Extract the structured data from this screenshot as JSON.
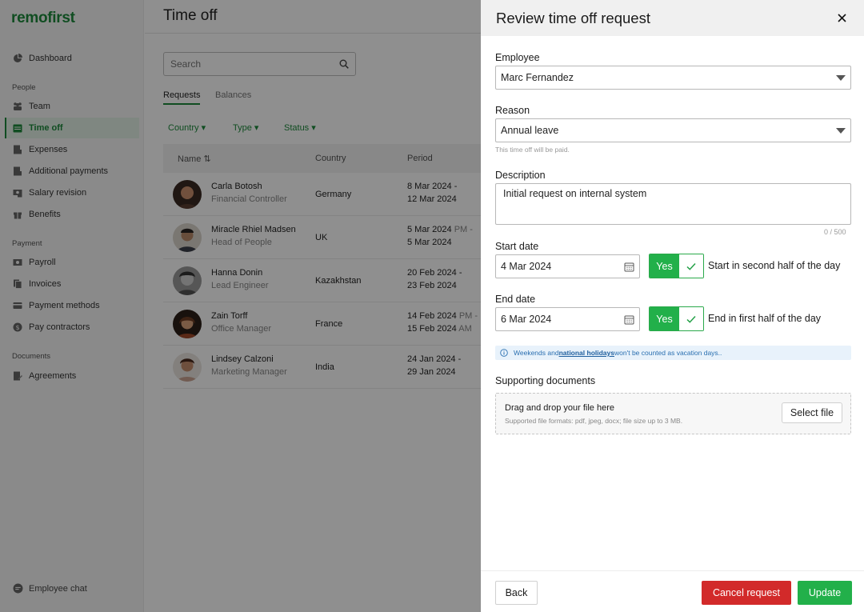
{
  "app": {
    "logo": "remofirst",
    "page_title": "Time off"
  },
  "sidebar": {
    "dashboard": "Dashboard",
    "section_people": "People",
    "team": "Team",
    "time_off": "Time off",
    "expenses": "Expenses",
    "additional_payments": "Additional payments",
    "salary_revision": "Salary revision",
    "benefits": "Benefits",
    "section_payment": "Payment",
    "payroll": "Payroll",
    "invoices": "Invoices",
    "payment_methods": "Payment methods",
    "pay_contractors": "Pay contractors",
    "section_documents": "Documents",
    "agreements": "Agreements",
    "employee_chat": "Employee chat"
  },
  "main": {
    "search_placeholder": "Search",
    "tabs": [
      "Requests",
      "Balances"
    ],
    "filters": [
      "Country",
      "Type",
      "Status"
    ],
    "columns": {
      "name": "Name ⇅",
      "country": "Country",
      "period": "Period"
    },
    "rows": [
      {
        "name": "Carla Botosh",
        "role": "Financial Controller",
        "country": "Germany",
        "p1": "8 Mar 2024 -",
        "p1_suffix": "",
        "p2": "12 Mar 2024",
        "p2_suffix": ""
      },
      {
        "name": "Miracle Rhiel Madsen",
        "role": "Head of People",
        "country": "UK",
        "p1": "5 Mar 2024",
        "p1_suffix": " PM -",
        "p2": "5 Mar 2024",
        "p2_suffix": ""
      },
      {
        "name": "Hanna Donin",
        "role": "Lead Engineer",
        "country": "Kazakhstan",
        "p1": "20 Feb 2024 -",
        "p1_suffix": "",
        "p2": "23 Feb 2024",
        "p2_suffix": ""
      },
      {
        "name": "Zain Torff",
        "role": "Office Manager",
        "country": "France",
        "p1": "14 Feb 2024",
        "p1_suffix": " PM -",
        "p2": "15 Feb 2024",
        "p2_suffix": " AM"
      },
      {
        "name": "Lindsey Calzoni",
        "role": "Marketing Manager",
        "country": "India",
        "p1": "24 Jan 2024 -",
        "p1_suffix": "",
        "p2": "29 Jan 2024",
        "p2_suffix": ""
      }
    ]
  },
  "drawer": {
    "title": "Review time off request",
    "employee_label": "Employee",
    "employee_value": "Marc Fernandez",
    "reason_label": "Reason",
    "reason_value": "Annual leave",
    "reason_hint": "This time off will be paid.",
    "description_label": "Description",
    "description_value": "Initial request on internal system",
    "description_counter": "0 / 500",
    "start_label": "Start date",
    "start_value": "4 Mar 2024",
    "start_toggle": "Yes",
    "start_toggle_label": "Start in second half of the day",
    "end_label": "End date",
    "end_value": "6 Mar 2024",
    "end_toggle": "Yes",
    "end_toggle_label": "End in first half of the day",
    "info_pre": "Weekends and ",
    "info_link": "national holidays",
    "info_post": " won't be counted as vacation days..",
    "docs_label": "Supporting documents",
    "dropzone_title": "Drag and drop your file here",
    "dropzone_sub": "Supported file formats: pdf, jpeg, docx; file size up to 3 MB.",
    "select_file": "Select file",
    "back": "Back",
    "cancel_request": "Cancel request",
    "update": "Update"
  },
  "colors": {
    "brand": "#1d8a3c",
    "accent_green": "#22b04a",
    "danger": "#d22a2a",
    "info_bg": "#e8f2fb"
  }
}
